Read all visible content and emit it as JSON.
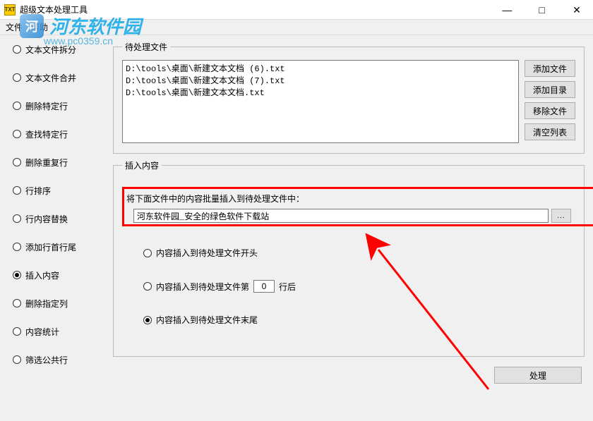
{
  "window": {
    "title": "超级文本处理工具",
    "icon_label": "TXT",
    "minimize": "—",
    "maximize": "□",
    "close": "✕"
  },
  "menu": {
    "file": "文件",
    "help": "帮助"
  },
  "sidebar": {
    "items": [
      {
        "label": "文本文件拆分"
      },
      {
        "label": "文本文件合并"
      },
      {
        "label": "删除特定行"
      },
      {
        "label": "查找特定行"
      },
      {
        "label": "删除重复行"
      },
      {
        "label": "行排序"
      },
      {
        "label": "行内容替换"
      },
      {
        "label": "添加行首行尾"
      },
      {
        "label": "插入内容"
      },
      {
        "label": "删除指定列"
      },
      {
        "label": "内容统计"
      },
      {
        "label": "筛选公共行"
      }
    ],
    "selected_index": 8
  },
  "files": {
    "legend": "待处理文件",
    "list": [
      "D:\\tools\\桌面\\新建文本文档 (6).txt",
      "D:\\tools\\桌面\\新建文本文档 (7).txt",
      "D:\\tools\\桌面\\新建文本文档.txt"
    ],
    "buttons": {
      "add_file": "添加文件",
      "add_dir": "添加目录",
      "remove": "移除文件",
      "clear": "清空列表"
    }
  },
  "insert": {
    "legend": "插入内容",
    "instruction": "将下面文件中的内容批量插入到待处理文件中：",
    "path_value": "河东软件园_安全的绿色软件下载站",
    "browse": "...",
    "options": {
      "opt1": "内容插入到待处理文件开头",
      "opt2_prefix": "内容插入到待处理文件第",
      "opt2_num": "0",
      "opt2_suffix": "行后",
      "opt3": "内容插入到待处理文件末尾"
    },
    "selected_option": 3
  },
  "footer": {
    "process": "处理"
  },
  "watermark": {
    "brand": "河东软件园",
    "url": "www.pc0359.cn"
  }
}
